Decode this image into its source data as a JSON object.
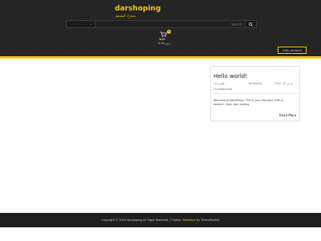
{
  "header": {
    "site_title": "darshoping",
    "tagline": "متجرك المفضل",
    "search": {
      "category_value": "",
      "placeholder": "Search"
    },
    "cart": {
      "count": "0",
      "label": "Total",
      "total": "0.00 ر.س"
    },
    "account_label": "My Account"
  },
  "post": {
    "title": "Hello world!",
    "date": "مارس 31, 2020",
    "author": "BinAhmed",
    "comments": "تعليق واحد",
    "category": "Uncategorized",
    "excerpt": "Welcome to WordPress. This is your first post. Edit or delete it, then start writing",
    "read_more": "Read More"
  },
  "footer": {
    "copyright": "Copyright © 2020 darshoping All Right Reserved.",
    "theme_prefix": "Theme:",
    "theme_name": "NewStore",
    "theme_by": "by ThemeFarmer"
  },
  "colors": {
    "accent": "#f5c518",
    "header_bg": "#242424",
    "footer_bg": "#1e1e1e"
  }
}
